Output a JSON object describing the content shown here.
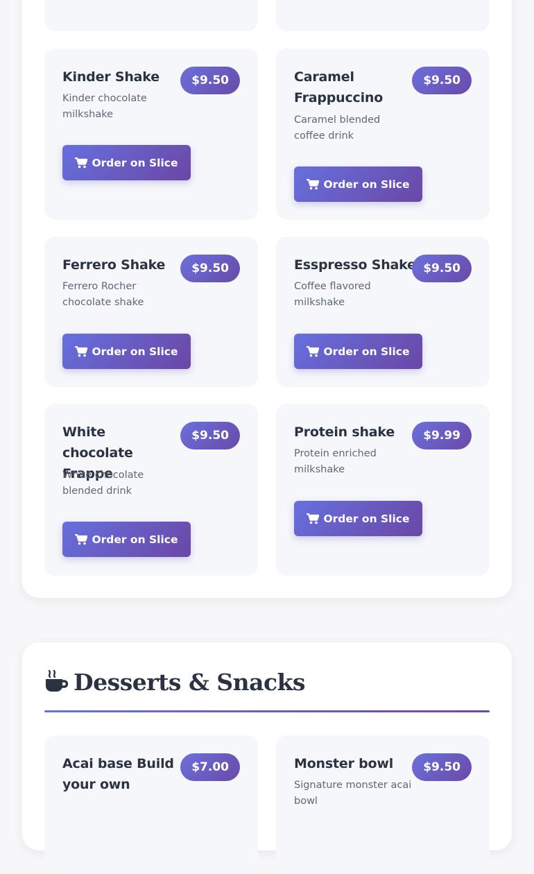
{
  "menu": {
    "order_label": "Order on Slice",
    "items": [
      {
        "name": "",
        "desc": "",
        "price": ""
      },
      {
        "name": "",
        "desc": "",
        "price": ""
      },
      {
        "name": "Kinder Shake",
        "desc": "Kinder chocolate milkshake",
        "price": "$9.50"
      },
      {
        "name": "Caramel Frappuccino",
        "desc": "Caramel blended coffee drink",
        "price": "$9.50"
      },
      {
        "name": "Ferrero Shake",
        "desc": "Ferrero Rocher chocolate shake",
        "price": "$9.50"
      },
      {
        "name": "Esspresso Shake",
        "desc": "Coffee flavored milkshake",
        "price": "$9.50"
      },
      {
        "name": "White chocolate Frappe",
        "desc": "White chocolate blended drink",
        "price": "$9.50"
      },
      {
        "name": "Protein shake",
        "desc": "Protein enriched milkshake",
        "price": "$9.99"
      }
    ]
  },
  "desserts": {
    "title": "Desserts & Snacks",
    "icon": "coffee-cup-icon",
    "items": [
      {
        "name": "Acai base Build your own",
        "desc": "",
        "price": "$7.00"
      },
      {
        "name": "Monster bowl",
        "desc": "Signature monster acai bowl",
        "price": "$9.50"
      }
    ]
  },
  "colors": {
    "accent_start": "#6b70dc",
    "accent_end": "#6a4aa8",
    "card_bg": "#f6f7fb",
    "text": "#2b3343"
  }
}
